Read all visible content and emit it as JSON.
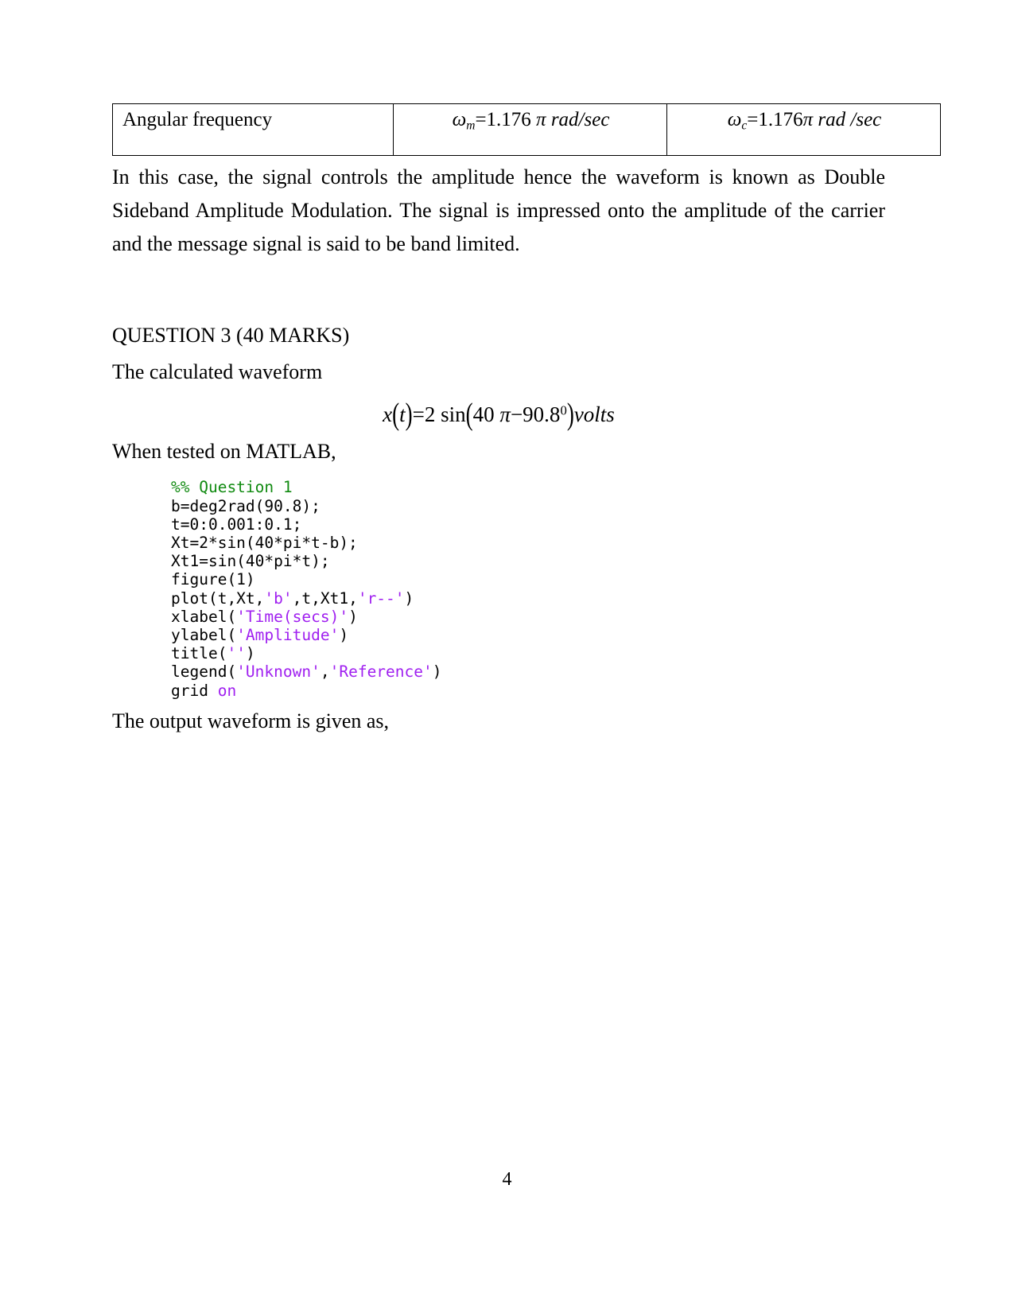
{
  "document": {
    "page_number": "4"
  },
  "table": {
    "rows": [
      {
        "label": "Angular frequency",
        "value_m": "ω m =1.176 π rad/sec",
        "value_c": "ω c =1.176 π rad /sec"
      }
    ]
  },
  "paragraphs": {
    "intro": "In this case, the signal controls the amplitude hence the waveform is known as Double Sideband Amplitude Modulation. The signal is impressed onto the amplitude of the carrier and the message signal is said to be band limited.",
    "question_heading": "QUESTION 3 (40 MARKS)",
    "calculated_waveform": "The calculated waveform",
    "when_tested": "When tested on MATLAB,",
    "output_waveform": "The output waveform is given as,"
  },
  "equation": {
    "full_text": "x(t)=2 sin(40π−90.8⁰) volts",
    "lhs": "x",
    "arg": "t",
    "rhs_coeff": "=2 sin",
    "inner": "40 π −90.8",
    "degree": "0",
    "unit": "volts"
  },
  "code": {
    "language": "matlab",
    "lines": [
      {
        "text": "%% Question 1",
        "type": "comment"
      },
      {
        "text": "b=deg2rad(90.8);",
        "type": "code"
      },
      {
        "text": "t=0:0.001:0.1;",
        "type": "code"
      },
      {
        "text": "Xt=2*sin(40*pi*t-b);",
        "type": "code"
      },
      {
        "text": "Xt1=sin(40*pi*t);",
        "type": "code"
      },
      {
        "text": "figure(1)",
        "type": "code"
      },
      {
        "text": "plot(t,Xt,'b',t,Xt1,'r--')",
        "type": "code"
      },
      {
        "text": "xlabel('Time(secs)')",
        "type": "code"
      },
      {
        "text": "ylabel('Amplitude')",
        "type": "code"
      },
      {
        "text": "title('')",
        "type": "code"
      },
      {
        "text": "legend('Unknown','Reference')",
        "type": "code"
      },
      {
        "text": "grid on",
        "type": "code"
      }
    ],
    "colors": {
      "comment": "#108a10",
      "string": "#a020f0",
      "plain": "#000000"
    }
  }
}
